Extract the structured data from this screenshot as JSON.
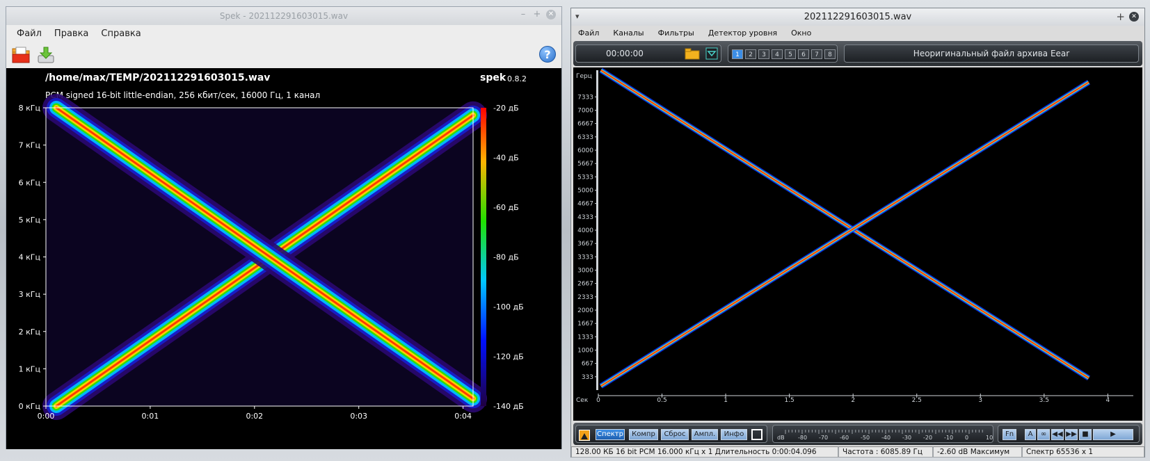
{
  "spek": {
    "window_title": "Spek - 202112291603015.wav",
    "menu": [
      "Файл",
      "Правка",
      "Справка"
    ],
    "file_path": "/home/max/TEMP/202112291603015.wav",
    "app_name": "spek",
    "version": "0.8.2",
    "format_info": "PCM signed 16-bit little-endian, 256 кбит/сек, 16000 Гц, 1 канал",
    "chart_data": {
      "type": "heatmap",
      "y_ticks": [
        "0 кГц",
        "1 кГц",
        "2 кГц",
        "3 кГц",
        "4 кГц",
        "5 кГц",
        "6 кГц",
        "7 кГц",
        "8 кГц"
      ],
      "x_ticks": [
        "0:00",
        "0:01",
        "0:02",
        "0:03",
        "0:04"
      ],
      "db_ticks": [
        "-20 дБ",
        "-40 дБ",
        "-60 дБ",
        "-80 дБ",
        "-100 дБ",
        "-120 дБ",
        "-140 дБ"
      ],
      "xlim": [
        0,
        4.096
      ],
      "ylim": [
        0,
        8000
      ],
      "series": [
        {
          "x": [
            0.1,
            4.096
          ],
          "y": [
            0,
            7800
          ]
        },
        {
          "x": [
            0.1,
            4.096
          ],
          "y": [
            8000,
            200
          ]
        }
      ]
    }
  },
  "eear": {
    "window_title": "202112291603015.wav",
    "menu": [
      "Файл",
      "Каналы",
      "Фильтры",
      "Детектор уровня",
      "Окно"
    ],
    "time": "00:00:00",
    "channels": [
      "1",
      "2",
      "3",
      "4",
      "5",
      "6",
      "7",
      "8"
    ],
    "status_text": "Неоригинальный файл архива Eear",
    "y_unit": "Герц",
    "x_unit": "Сек",
    "chart_data": {
      "type": "heatmap",
      "y_ticks": [
        "7333",
        "7000",
        "6667",
        "6333",
        "6000",
        "5667",
        "5333",
        "5000",
        "4667",
        "4333",
        "4000",
        "3667",
        "3333",
        "3000",
        "2667",
        "2333",
        "2000",
        "1667",
        "1333",
        "1000",
        "667",
        "333"
      ],
      "x_ticks": [
        "0",
        "0.5",
        "1",
        "1.5",
        "2",
        "2.5",
        "3",
        "3.5",
        "4"
      ],
      "xlim": [
        0,
        4.2
      ],
      "ylim": [
        0,
        8000
      ]
    },
    "buttons": [
      "Спектр",
      "Компр",
      "Сброс",
      "Ампл.",
      "Инфо"
    ],
    "meter_label": "dB",
    "meter_ticks": [
      "-80",
      "-70",
      "-60",
      "-50",
      "-40",
      "-30",
      "-20",
      "-10",
      "0",
      "10"
    ],
    "right_buttons": [
      "Fn",
      "A"
    ],
    "status": {
      "file": "128.00 КБ 16 bit PCM 16.000 кГц x 1  Длительность 0:00:04.096",
      "freq": "Частота : 6085.89 Гц",
      "level": "-2.60 dB Максимум",
      "spectrum": "Спектр 65536 x 1"
    }
  }
}
